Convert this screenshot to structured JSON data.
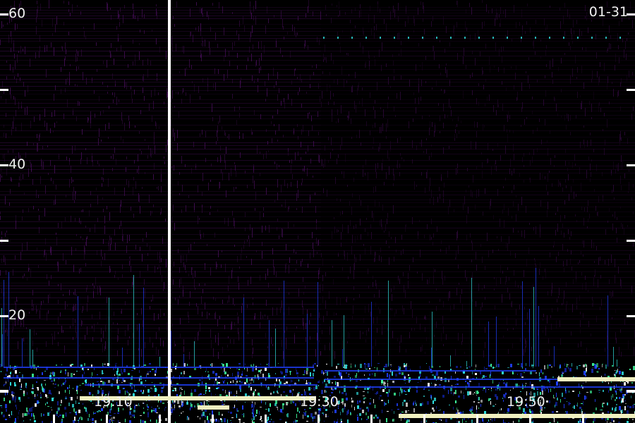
{
  "date_label": "01-31",
  "chart_data": {
    "type": "heatmap",
    "title": "",
    "xlabel": "",
    "ylabel": "",
    "y_ticks": [
      20,
      40,
      60
    ],
    "y_minor_ticks": [
      10,
      30,
      50
    ],
    "ylim": [
      8,
      60
    ],
    "x_tick_labels": [
      "19:10",
      "19:30",
      "19:50"
    ],
    "colors": {
      "background": "#000000",
      "noise": "#4a0f5e",
      "mid": "#2040ff",
      "high": "#30e0e0",
      "peak": "#f0f0c0",
      "axis": "#ffffff"
    },
    "events": [
      {
        "label": "19:10",
        "strength": "high"
      },
      {
        "label": "19:30",
        "strength": "high"
      },
      {
        "label": "19:50",
        "strength": "high"
      }
    ]
  }
}
